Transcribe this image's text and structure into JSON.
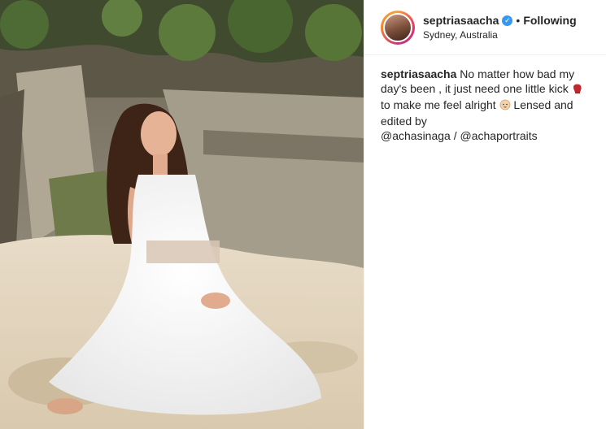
{
  "post": {
    "username": "septriasaacha",
    "separator": "•",
    "follow_status": "Following",
    "location": "Sydney, Australia",
    "caption": {
      "part1": "No matter how bad my day's been , it just need one little kick",
      "part2": "to make me feel alright",
      "part3": "Lensed and edited by",
      "mention1": "@achasinaga",
      "slash": " / ",
      "mention2": "@achaportraits"
    }
  },
  "icons": {
    "verified": "verified-badge-icon",
    "emoji1": "boxing-glove-emoji",
    "emoji2": "baby-emoji"
  },
  "colors": {
    "verified": "#3897f0",
    "text": "#262626"
  }
}
